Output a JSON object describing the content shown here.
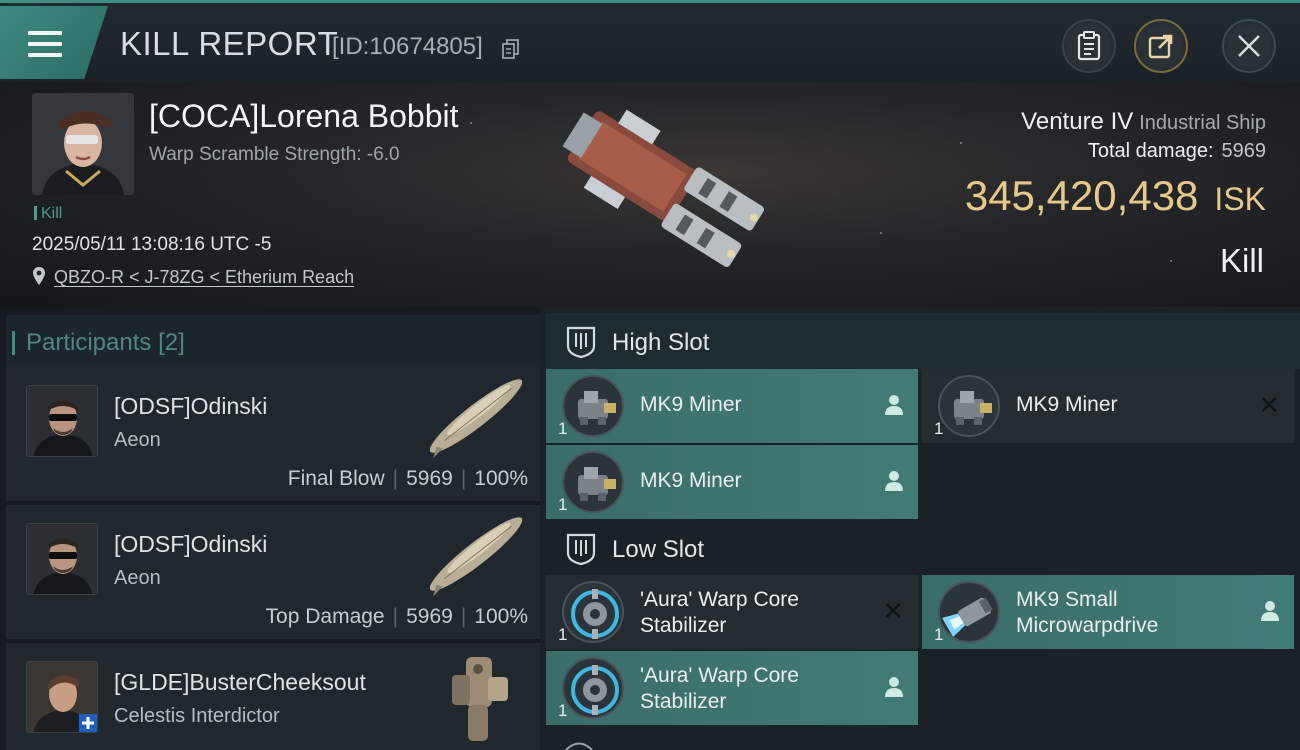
{
  "header": {
    "title": "KILL REPORT",
    "id_text": "[ID:10674805]",
    "buttons": [
      "clipboard-icon",
      "share-icon",
      "close-icon"
    ]
  },
  "victim": {
    "name": "[COCA]Lorena Bobbit",
    "subtitle": "Warp Scramble Strength: -6.0",
    "tag": "Kill",
    "datetime": "2025/05/11 13:08:16 UTC -5",
    "location": "QBZO-R < J-78ZG < Etherium Reach",
    "ship": "Venture IV",
    "ship_class": "Industrial Ship",
    "total_damage_label": "Total damage:",
    "total_damage": "5969",
    "isk_value": "345,420,438",
    "isk_unit": "ISK",
    "result": "Kill"
  },
  "participants": {
    "title": "Participants",
    "count": "[2]",
    "items": [
      {
        "name": "[ODSF]Odinski",
        "ship": "Aeon",
        "role": "Final Blow",
        "damage": "5969",
        "percent": "100%"
      },
      {
        "name": "[ODSF]Odinski",
        "ship": "Aeon",
        "role": "Top Damage",
        "damage": "5969",
        "percent": "100%"
      },
      {
        "name": "[GLDE]BusterCheeksout",
        "ship": "Celestis Interdictor"
      }
    ]
  },
  "slots": {
    "high": {
      "title": "High Slot",
      "modules": [
        {
          "name": "MK9 Miner",
          "qty": "1",
          "state": "dropped"
        },
        {
          "name": "MK9 Miner",
          "qty": "1",
          "state": "destroyed"
        },
        {
          "name": "MK9 Miner",
          "qty": "1",
          "state": "dropped"
        }
      ]
    },
    "low": {
      "title": "Low Slot",
      "modules": [
        {
          "name": "'Aura' Warp Core Stabilizer",
          "line1": "'Aura' Warp Core",
          "line2": "Stabilizer",
          "qty": "1",
          "state": "destroyed"
        },
        {
          "name": "MK9 Small Microwarpdrive",
          "line1": "MK9 Small",
          "line2": "Microwarpdrive",
          "qty": "1",
          "state": "dropped"
        },
        {
          "name": "'Aura' Warp Core Stabilizer",
          "line1": "'Aura' Warp Core",
          "line2": "Stabilizer",
          "qty": "1",
          "state": "dropped"
        }
      ]
    }
  },
  "colors": {
    "accent": "#3e8a80",
    "isk": "#e7c98a",
    "module_on": "#3f7771",
    "module_off": "#252c31"
  }
}
